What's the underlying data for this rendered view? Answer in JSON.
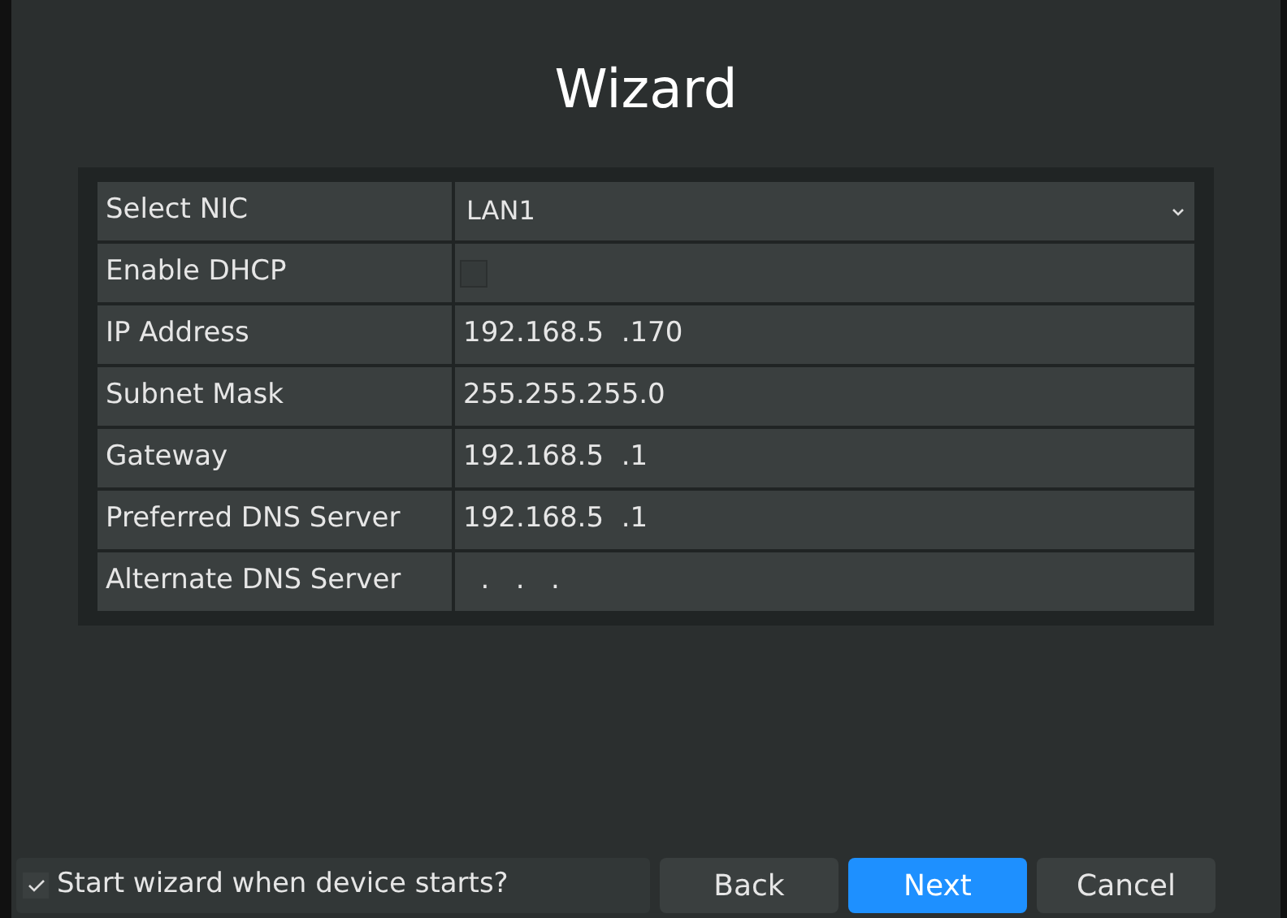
{
  "window": {
    "title": "Wizard"
  },
  "fields": [
    {
      "label": "Select NIC",
      "kind": "select",
      "value": "LAN1"
    },
    {
      "label": "Enable DHCP",
      "kind": "checkbox",
      "checked": false
    },
    {
      "label": "IP Address",
      "kind": "text",
      "value": "192.168.5  .170"
    },
    {
      "label": "Subnet Mask",
      "kind": "text",
      "value": "255.255.255.0"
    },
    {
      "label": "Gateway",
      "kind": "text",
      "value": "192.168.5  .1"
    },
    {
      "label": "Preferred DNS Server",
      "kind": "text",
      "value": "192.168.5  .1"
    },
    {
      "label": "Alternate DNS Server",
      "kind": "text",
      "value": "  .   .   ."
    }
  ],
  "startup_option": {
    "label": "Start wizard when device starts?",
    "checked": true
  },
  "buttons": [
    {
      "label": "Back",
      "focused": false
    },
    {
      "label": "Next",
      "focused": true
    },
    {
      "label": "Cancel",
      "focused": false
    }
  ]
}
